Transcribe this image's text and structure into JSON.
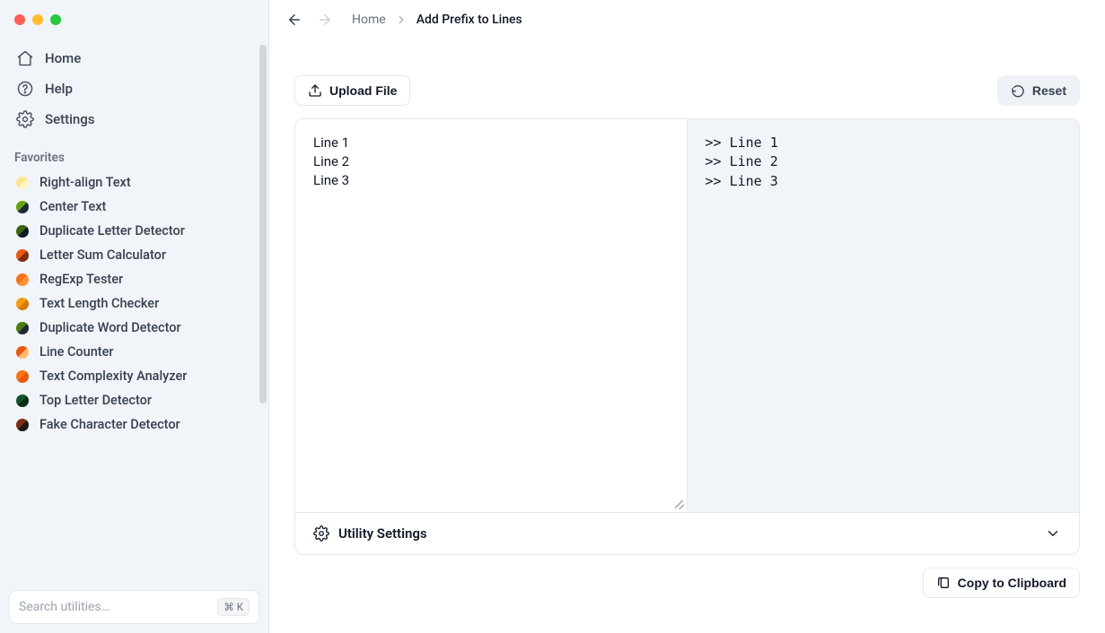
{
  "sidebar": {
    "nav": [
      {
        "label": "Home"
      },
      {
        "label": "Help"
      },
      {
        "label": "Settings"
      }
    ],
    "favorites_header": "Favorites",
    "favorites": [
      {
        "label": "Right-align Text",
        "color1": "#fde68a",
        "color2": "#fef3c7"
      },
      {
        "label": "Center Text",
        "color1": "#65a30d",
        "color2": "#1f2937"
      },
      {
        "label": "Duplicate Letter Detector",
        "color1": "#3f6212",
        "color2": "#111827"
      },
      {
        "label": "Letter Sum Calculator",
        "color1": "#ea580c",
        "color2": "#7c2d12"
      },
      {
        "label": "RegExp Tester",
        "color1": "#f97316",
        "color2": "#fb923c"
      },
      {
        "label": "Text Length Checker",
        "color1": "#f59e0b",
        "color2": "#d97706"
      },
      {
        "label": "Duplicate Word Detector",
        "color1": "#4d7c0f",
        "color2": "#1f2937"
      },
      {
        "label": "Line Counter",
        "color1": "#ea580c",
        "color2": "#fdba74"
      },
      {
        "label": "Text Complexity Analyzer",
        "color1": "#f97316",
        "color2": "#ea580c"
      },
      {
        "label": "Top Letter Detector",
        "color1": "#14532d",
        "color2": "#052e16"
      },
      {
        "label": "Fake Character Detector",
        "color1": "#7c2d12",
        "color2": "#1c1917"
      }
    ],
    "search_placeholder": "Search utilities…",
    "search_kbd": "⌘ K"
  },
  "breadcrumb": {
    "home": "Home",
    "current": "Add Prefix to Lines"
  },
  "toolbar": {
    "upload": "Upload File",
    "reset": "Reset"
  },
  "input_text": "Line 1\nLine 2\nLine 3",
  "output_text": ">> Line 1\n>> Line 2\n>> Line 3",
  "settings_label": "Utility Settings",
  "copy_label": "Copy to Clipboard"
}
